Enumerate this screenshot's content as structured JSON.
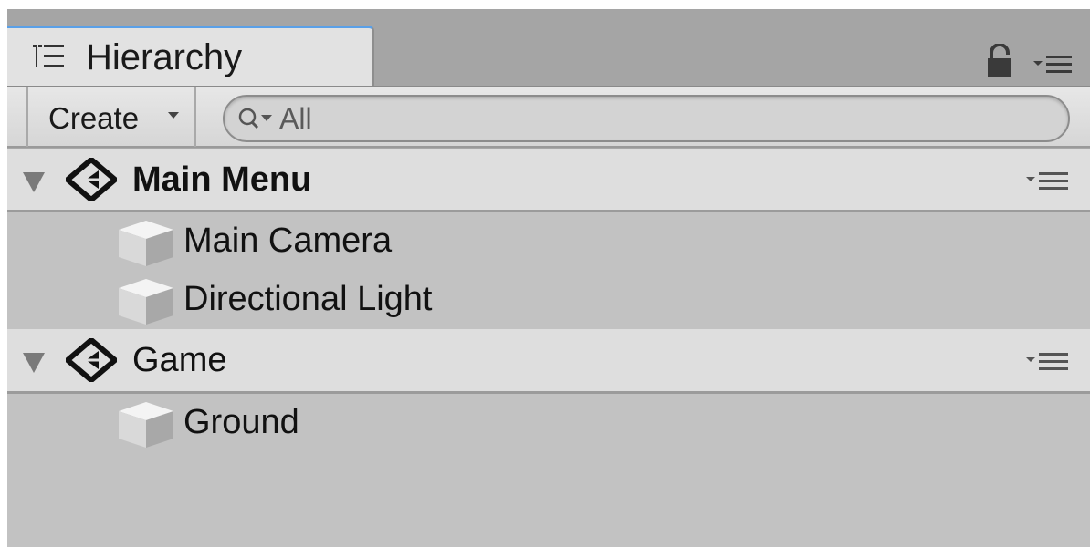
{
  "window": {
    "tab_title": "Hierarchy",
    "tab_icon": "hierarchy-list-icon",
    "lock_icon": "lock-icon",
    "menu_icon": "panel-menu-icon"
  },
  "toolbar": {
    "create_label": "Create",
    "search_placeholder": "All",
    "search_value": ""
  },
  "scenes": [
    {
      "name": "Main Menu",
      "active": true,
      "expanded": true,
      "objects": [
        "Main Camera",
        "Directional Light"
      ]
    },
    {
      "name": "Game",
      "active": false,
      "expanded": true,
      "objects": [
        "Ground"
      ]
    }
  ],
  "colors": {
    "panel_bg": "#c2c2c2",
    "scene_row_bg": "#dedede",
    "tab_accent": "#5aa0e8"
  }
}
